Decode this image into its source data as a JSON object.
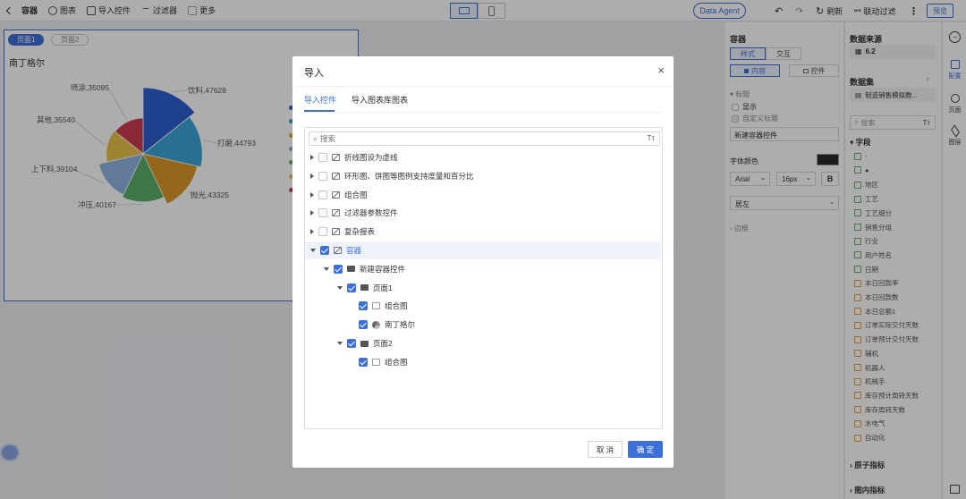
{
  "topbar": {
    "back_icon": "chevron-left-icon",
    "title": "容器",
    "items": [
      {
        "label": "图表",
        "icon": "chart-icon"
      },
      {
        "label": "导入控件",
        "icon": "import-icon"
      },
      {
        "label": "过滤器",
        "icon": "filter-icon"
      },
      {
        "label": "更多",
        "icon": "grid-icon"
      }
    ],
    "agent_label": "Data Agent",
    "refresh_label": "刷新",
    "linkage_label": "联动过滤",
    "preview_label": "预览"
  },
  "canvas": {
    "page_tabs": [
      "页面1",
      "页面2"
    ],
    "chart_title": "南丁格尔",
    "legend_colors": [
      "#2f5fd0",
      "#3aa6d6",
      "#e8a636",
      "#8fb4e0",
      "#5bb06a",
      "#e8c14a",
      "#cc3d4e"
    ]
  },
  "chart_data": {
    "type": "pie",
    "title": "南丁格尔",
    "labels": [
      "饮料",
      "打磨",
      "抛光",
      "冲压",
      "上下料",
      "其他",
      "喷涂"
    ],
    "values": [
      47628,
      44793,
      43325,
      40167,
      39104,
      35540,
      35095
    ],
    "colors": [
      "#2f5fd0",
      "#3aa6d6",
      "#d99a2b",
      "#5bb06a",
      "#8fb4e0",
      "#e8c14a",
      "#cc3d4e"
    ],
    "data_labels": [
      "饮料,47628",
      "打磨,44793",
      "抛光,43325",
      "冲压,40167",
      "上下料,39104",
      "其他,35540",
      "喷涂,35095"
    ]
  },
  "settings_panel": {
    "title": "容器",
    "tabs": [
      "样式",
      "交互"
    ],
    "subtabs": [
      "内容",
      "控件"
    ],
    "title_label": "标题",
    "show_label": "显示",
    "custom_title_label": "自定义标题",
    "title_value": "新建容器控件",
    "font_color_label": "字体颜色",
    "font_family": "Arial",
    "font_size": "16px",
    "bold_label": "B",
    "align": "居左",
    "border_label": "边框"
  },
  "data_panel": {
    "source_title": "数据来源",
    "source_value": "6.2",
    "dataset_title": "数据集",
    "dataset_value": "制造销售模拟数...",
    "search_placeholder": "搜索",
    "fields_title": "字段",
    "fields": [
      {
        "name": "-",
        "kind": "dim"
      },
      {
        "name": "●",
        "kind": "dim"
      },
      {
        "name": "地区",
        "kind": "dim"
      },
      {
        "name": "工艺",
        "kind": "dim"
      },
      {
        "name": "工艺细分",
        "kind": "dim"
      },
      {
        "name": "销售分组",
        "kind": "dim"
      },
      {
        "name": "行业",
        "kind": "dim"
      },
      {
        "name": "用户姓名",
        "kind": "dim"
      },
      {
        "name": "日期",
        "kind": "dim"
      },
      {
        "name": "本日回款率",
        "kind": "measure"
      },
      {
        "name": "本日回款数",
        "kind": "measure"
      },
      {
        "name": "本日总额1",
        "kind": "measure"
      },
      {
        "name": "订单实际交付天数",
        "kind": "measure"
      },
      {
        "name": "订单预计交付天数",
        "kind": "measure"
      },
      {
        "name": "辅机",
        "kind": "measure"
      },
      {
        "name": "机器人",
        "kind": "measure"
      },
      {
        "name": "机械手",
        "kind": "measure"
      },
      {
        "name": "库存预计周转天数",
        "kind": "measure"
      },
      {
        "name": "库存周转天数",
        "kind": "measure"
      },
      {
        "name": "水电气",
        "kind": "measure"
      },
      {
        "name": "自动化",
        "kind": "measure"
      }
    ],
    "atomic_metrics": "原子指标",
    "chart_metrics": "图内指标"
  },
  "side_rail": [
    "配置",
    "页面",
    "图层"
  ],
  "modal": {
    "title": "导入",
    "tabs": [
      "导入控件",
      "导入图表库图表"
    ],
    "search_placeholder": "搜索",
    "tree": [
      {
        "label": "折线图设为虚线",
        "level": 0,
        "checked": false,
        "expanded": false,
        "arrow": true,
        "icon": "ln",
        "hl": false
      },
      {
        "label": "环形图、饼图等图例支持度量和百分比",
        "level": 0,
        "checked": false,
        "expanded": false,
        "arrow": true,
        "icon": "ln",
        "hl": false
      },
      {
        "label": "组合图",
        "level": 0,
        "checked": false,
        "expanded": false,
        "arrow": true,
        "icon": "ln",
        "hl": false
      },
      {
        "label": "过滤器参数控件",
        "level": 0,
        "checked": false,
        "expanded": false,
        "arrow": true,
        "icon": "ln",
        "hl": false
      },
      {
        "label": "复杂报表",
        "level": 0,
        "checked": false,
        "expanded": false,
        "arrow": true,
        "icon": "ln",
        "hl": false
      },
      {
        "label": "容器",
        "level": 0,
        "checked": true,
        "expanded": true,
        "arrow": true,
        "icon": "ln",
        "hl": true
      },
      {
        "label": "新建容器控件",
        "level": 1,
        "checked": true,
        "expanded": true,
        "arrow": true,
        "icon": "pg",
        "hl": false
      },
      {
        "label": "页面1",
        "level": 2,
        "checked": true,
        "expanded": true,
        "arrow": true,
        "icon": "pg",
        "hl": false
      },
      {
        "label": "组合图",
        "level": 3,
        "checked": true,
        "expanded": false,
        "arrow": false,
        "icon": "ch",
        "hl": false
      },
      {
        "label": "南丁格尔",
        "level": 3,
        "checked": true,
        "expanded": false,
        "arrow": false,
        "icon": "pie",
        "hl": false
      },
      {
        "label": "页面2",
        "level": 2,
        "checked": true,
        "expanded": true,
        "arrow": true,
        "icon": "pg",
        "hl": false
      },
      {
        "label": "组合图",
        "level": 3,
        "checked": true,
        "expanded": false,
        "arrow": false,
        "icon": "ch",
        "hl": false
      }
    ],
    "cancel_label": "取 消",
    "ok_label": "确 定"
  }
}
